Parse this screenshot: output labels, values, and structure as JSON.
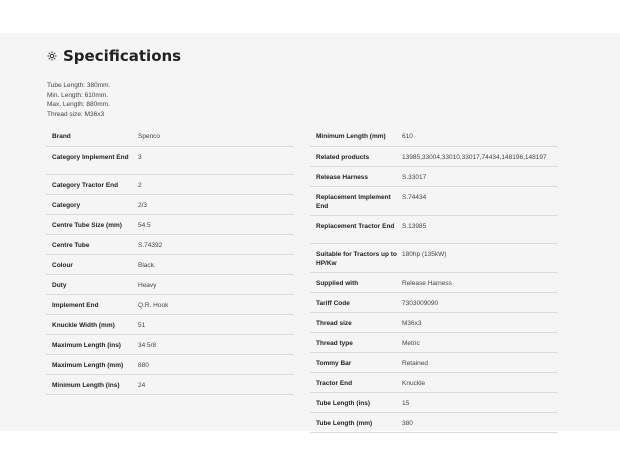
{
  "section": {
    "title": "Specifications",
    "icon": "gear-icon",
    "description": [
      "Tube Length: 380mm.",
      "Min. Length: 610mm.",
      "Max. Length: 880mm.",
      "Thread size: M36x3"
    ]
  },
  "left_rows": [
    {
      "key": "Brand",
      "value": "Spenco"
    },
    {
      "key": "Category Implement End",
      "value": "3"
    },
    {
      "key": "Category Tractor End",
      "value": "2"
    },
    {
      "key": "Category",
      "value": "2/3"
    },
    {
      "key": "Centre Tube Size (mm)",
      "value": "54.5"
    },
    {
      "key": "Centre Tube",
      "value": "S.74392"
    },
    {
      "key": "Colour",
      "value": "Black."
    },
    {
      "key": "Duty",
      "value": "Heavy"
    },
    {
      "key": "Implement End",
      "value": "Q.R. Hook"
    },
    {
      "key": "Knuckle Width (mm)",
      "value": "51"
    },
    {
      "key": "Maximum Length (ins)",
      "value": "34 5/8"
    },
    {
      "key": "Maximum Length (mm)",
      "value": "880"
    },
    {
      "key": "Minimum Length (ins)",
      "value": "24"
    }
  ],
  "right_rows": [
    {
      "key": "Minimum Length (mm)",
      "value": "610"
    },
    {
      "key": "Related products",
      "value": "13985,33004,33010,33017,74434,148196,148197"
    },
    {
      "key": "Release Harness",
      "value": "S.33017"
    },
    {
      "key": "Replacement Implement End",
      "value": "S.74434"
    },
    {
      "key": "Replacement Tractor End",
      "value": "S.13985"
    },
    {
      "key": "Suitable for Tractors up to HP/Kw",
      "value": "180hp (135kW)"
    },
    {
      "key": "Supplied with",
      "value": "Release Harness"
    },
    {
      "key": "Tariff Code",
      "value": "7303009090"
    },
    {
      "key": "Thread size",
      "value": "M36x3"
    },
    {
      "key": "Thread type",
      "value": "Metric"
    },
    {
      "key": "Tommy Bar",
      "value": "Retained"
    },
    {
      "key": "Tractor End",
      "value": "Knuckle"
    },
    {
      "key": "Tube Length (ins)",
      "value": "15"
    },
    {
      "key": "Tube Length (mm)",
      "value": "380"
    }
  ]
}
